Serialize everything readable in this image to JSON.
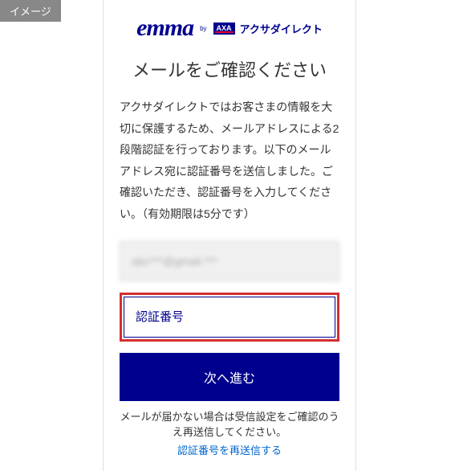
{
  "badge": "イメージ",
  "logo": {
    "emma": "emma",
    "by": "by",
    "axa": "AXA",
    "axaDirect": "アクサダイレクト"
  },
  "heading": "メールをご確認ください",
  "description": "アクサダイレクトではお客さまの情報を大切に保護するため、メールアドレスによる2段階認証を行っております。以下のメールアドレス宛に認証番号を送信しました。ご確認いただき、認証番号を入力してください。（有効期限は5分です）",
  "emailDisplay": "abc***@gmail.***",
  "codeInput": {
    "placeholder": "認証番号"
  },
  "nextButton": "次へ進む",
  "resendText": "メールが届かない場合は受信設定をご確認のうえ再送信してください。",
  "resendLink": "認証番号を再送信する"
}
